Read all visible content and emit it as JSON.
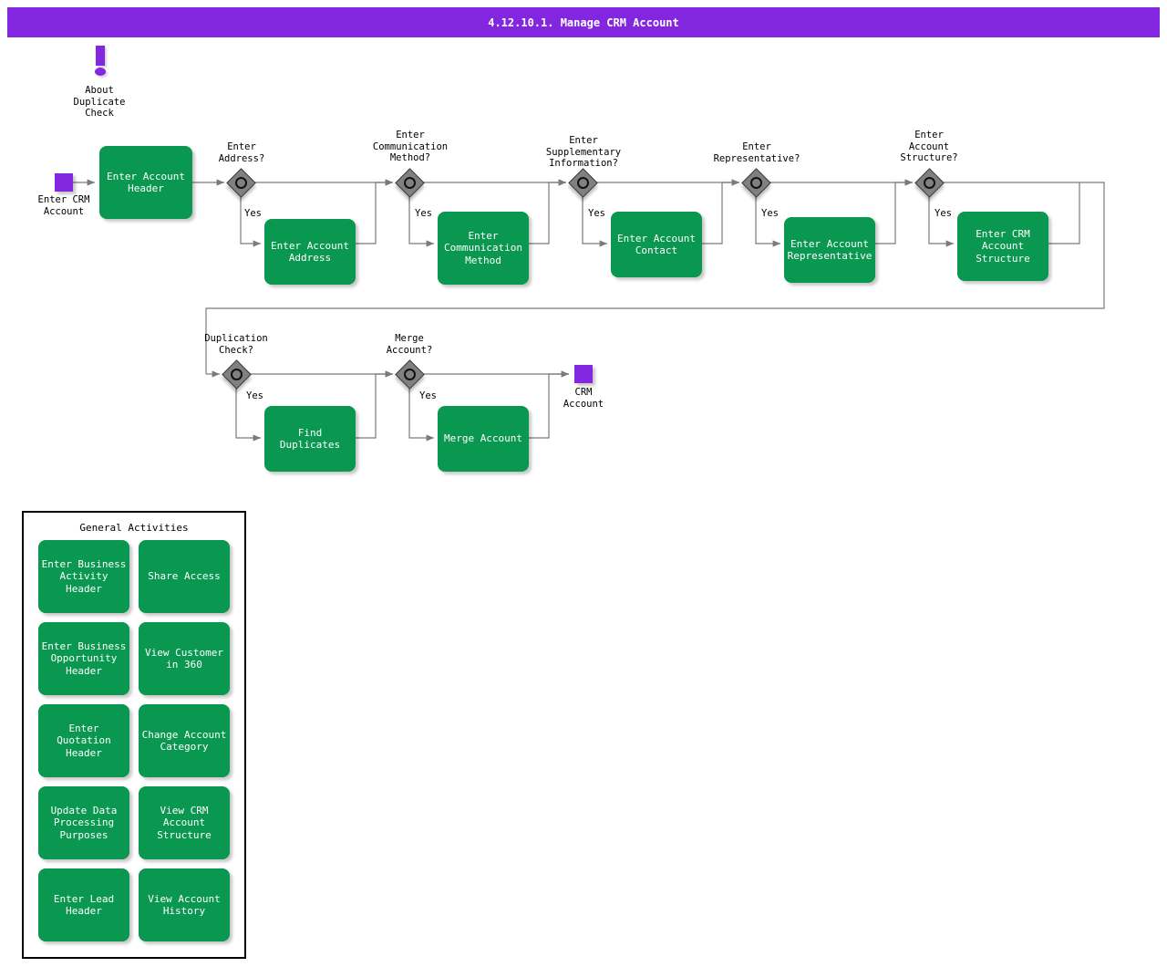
{
  "window": {
    "title": "4.12.10.1. Manage CRM Account",
    "title_bar_color": "#8326e0"
  },
  "colors": {
    "task_green": "#0a9750",
    "event_purple": "#8326e0",
    "gateway_gray": "#808080",
    "edge_gray": "#7a7a7a",
    "text_white": "#ffffff",
    "text_black": "#000000"
  },
  "annotation": {
    "icon": "exclamation-icon",
    "label": "About\nDuplicate\nCheck"
  },
  "start_event": {
    "name": "start-event",
    "label": "Enter CRM\nAccount"
  },
  "end_event": {
    "name": "end-event",
    "label": "CRM\nAccount"
  },
  "branch_label": "Yes",
  "row1": {
    "first_task": "Enter Account\nHeader",
    "steps": [
      {
        "gateway": "Enter\nAddress?",
        "task": "Enter Account\nAddress"
      },
      {
        "gateway": "Enter\nCommunication\nMethod?",
        "task": "Enter\nCommunication\nMethod"
      },
      {
        "gateway": "Enter\nSupplementary\nInformation?",
        "task": "Enter Account\nContact"
      },
      {
        "gateway": "Enter\nRepresentative?",
        "task": "Enter Account\nRepresentative"
      },
      {
        "gateway": "Enter\nAccount\nStructure?",
        "task": "Enter CRM\nAccount\nStructure"
      }
    ]
  },
  "row2": {
    "steps": [
      {
        "gateway": "Duplication\nCheck?",
        "task": "Find Duplicates"
      },
      {
        "gateway": "Merge\nAccount?",
        "task": "Merge Account"
      }
    ]
  },
  "general_activities": {
    "title": "General Activities",
    "items": [
      "Enter Business\nActivity Header",
      "Share Access",
      "Enter Business\nOpportunity\nHeader",
      "View Customer\nin 360",
      "Enter Quotation\nHeader",
      "Change Account\nCategory",
      "Update Data\nProcessing\nPurposes",
      "View CRM\nAccount\nStructure",
      "Enter Lead\nHeader",
      "View Account\nHistory"
    ]
  }
}
